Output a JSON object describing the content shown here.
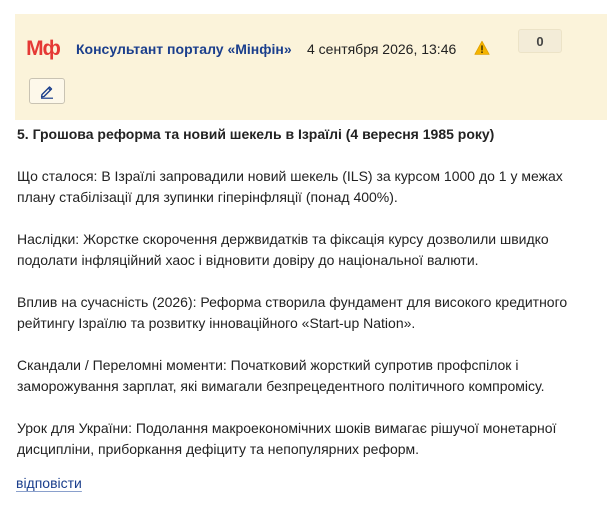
{
  "comment": {
    "logo": "Мф",
    "author": "Консультант порталу «Мінфін»",
    "date": "4 сентября 2026, 13:46",
    "rating": "0",
    "title": "5. Грошова реформа та новий шекель в Ізраїлі (4 вересня 1985 року)",
    "paragraphs": [
      "Що сталося: В Ізраїлі запровадили новий шекель (ILS) за курсом 1000 до 1 у межах плану стабілізації для зупинки гіперінфляції (понад 400%).",
      "Наслідки: Жорстке скорочення держвидатків та фіксація курсу дозволили швидко подолати інфляційний хаос і відновити довіру до національної валюти.",
      "Вплив на сучасність (2026): Реформа створила фундамент для високого кредитного рейтингу Ізраїлю та розвитку інноваційного «Start-up Nation».",
      "Скандали / Переломні моменти: Початковий жорсткий супротив профспілок і заморожування зарплат, які вимагали безпрецедентного політичного компромісу.",
      "Урок для України: Подолання макроекономічних шоків вимагає рішучої монетарної дисципліни, приборкання дефіциту та непопулярних реформ."
    ],
    "reply_label": "відповісти"
  },
  "icons": {
    "warning": "warning-icon",
    "edit": "pencil-icon"
  },
  "colors": {
    "header_bg": "#fbf3da",
    "author": "#1a3e8c",
    "logo": "#e53935",
    "warning": "#f5b400"
  }
}
